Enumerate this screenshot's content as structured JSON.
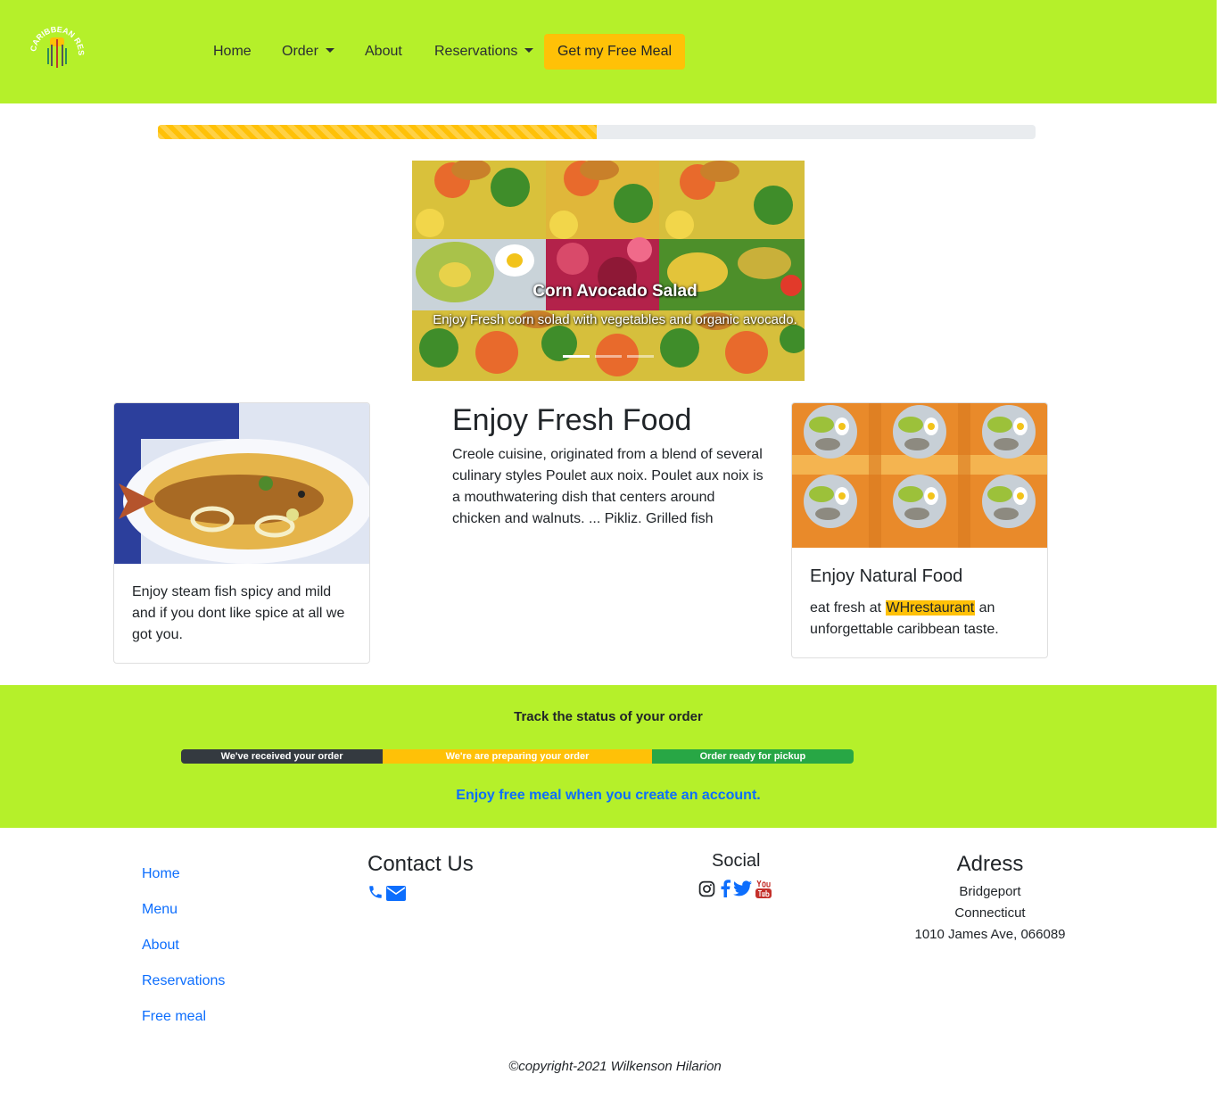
{
  "brand": {
    "logo_text": "CARIBBEAN RESTAURANT"
  },
  "nav": {
    "home": "Home",
    "order": "Order",
    "about": "About",
    "reservations": "Reservations",
    "cta": "Get my Free Meal"
  },
  "progress": {
    "value_percent": 50
  },
  "carousel": {
    "title": "Corn Avocado Salad",
    "text": "Enjoy Fresh corn solad with vegetables and organic avocado.",
    "active_slide": 1,
    "slide_count": 3
  },
  "card_left": {
    "text": "Enjoy steam fish spicy and mild and if you dont like spice at all we got you."
  },
  "middle": {
    "title": "Enjoy Fresh Food",
    "text": "Creole cuisine, originated from a blend of several culinary styles Poulet aux noix. Poulet aux noix is a mouthwatering dish that centers around chicken and walnuts. ... Pikliz. Grilled fish"
  },
  "card_right": {
    "title": "Enjoy Natural Food",
    "text_before": "eat fresh at ",
    "highlight": "WHrestaurant",
    "text_after": " an unforgettable caribbean taste."
  },
  "tracking": {
    "title": "Track the status of your order",
    "steps": [
      {
        "label": "We've received your order",
        "color": "#343a40",
        "share": 0.3
      },
      {
        "label": "We're are preparing your order",
        "color": "#ffc107",
        "share": 0.4
      },
      {
        "label": "Order ready for pickup",
        "color": "#28a745",
        "share": 0.3
      }
    ],
    "promo": "Enjoy free meal when you create an account."
  },
  "footer": {
    "links": [
      "Home",
      "Menu",
      "About",
      "Reservations",
      "Free meal"
    ],
    "contact_title": "Contact Us",
    "social_title": "Social",
    "address_title": "Adress",
    "address_lines": [
      "Bridgeport",
      "Connecticut",
      "1010 James Ave, 066089"
    ],
    "copyright": "©copyright-2021 Wilkenson Hilarion"
  },
  "colors": {
    "brand_green": "#b5f02a",
    "accent_yellow": "#ffc107",
    "link_blue": "#0d6efd"
  }
}
